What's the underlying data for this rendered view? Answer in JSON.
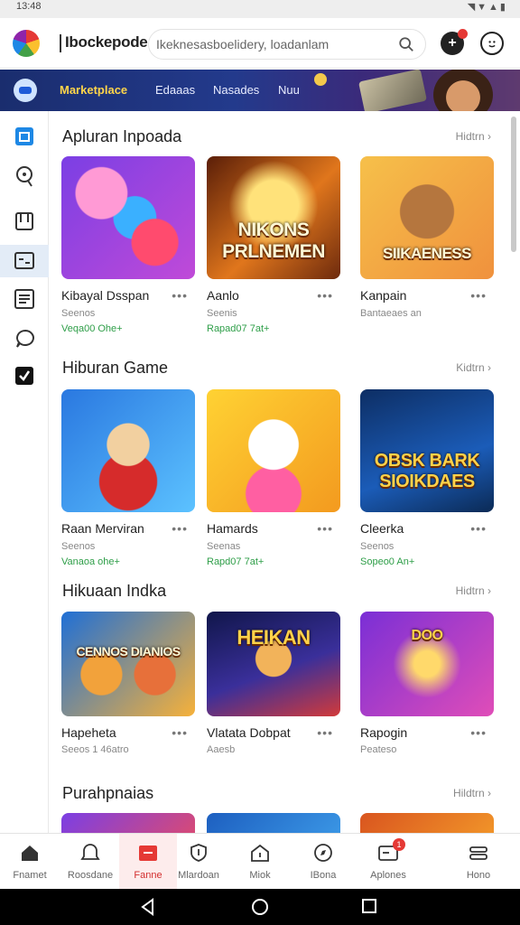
{
  "status_bar": {
    "time": "13:48"
  },
  "header": {
    "app_title": "Ibockepode",
    "search_placeholder": "Ikeknesasboelidery, loadanlam"
  },
  "banner": {
    "tabs": [
      {
        "label": "Marketplace",
        "active": true
      },
      {
        "label": "Edaaas",
        "active": false
      },
      {
        "label": "Nasades",
        "active": false
      },
      {
        "label": "Nuu",
        "active": false
      }
    ]
  },
  "sections": [
    {
      "title": "Apluran Inpoada",
      "see_all": "Hidtrn",
      "cards": [
        {
          "name": "Kibayal Dsspan",
          "sub": "Seenos",
          "meta": "Veqa00 Ohe+"
        },
        {
          "name": "Aanlo",
          "sub": "Seenis",
          "meta": "Rapad07 7at+",
          "art": "NIKONS PRLNEMEN"
        },
        {
          "name": "Kanpain",
          "sub": "Bantaeaes an",
          "meta": "",
          "art": "SIIKAENESS"
        }
      ]
    },
    {
      "title": "Hiburan Game",
      "see_all": "Kidtrn",
      "cards": [
        {
          "name": "Raan Merviran",
          "sub": "Seenos",
          "meta": "Vanaoa ohe+"
        },
        {
          "name": "Hamards",
          "sub": "Seenas",
          "meta": "Rapd07 7at+"
        },
        {
          "name": "Cleerka",
          "sub": "Seenos",
          "meta": "Sopeo0 An+",
          "art": "OBSK BARK SIOIKDAES"
        }
      ]
    },
    {
      "title": "Hikuaan Indka",
      "see_all": "Hidtrn",
      "cards": [
        {
          "name": "Hapeheta",
          "sub": "Seeos 1 46atro",
          "meta": "",
          "art": "CENNOS DIANIOS"
        },
        {
          "name": "Vlatata Dobpat",
          "sub": "Aaesb",
          "meta": "",
          "art": "HEIKAN"
        },
        {
          "name": "Rapogin",
          "sub": "Peateso",
          "meta": "",
          "art": "DOO"
        }
      ]
    },
    {
      "title": "Purahpnaias",
      "see_all": "Hildtrn",
      "cards": []
    }
  ],
  "bottom_nav": [
    {
      "label": "Fnamet",
      "icon": "home-icon",
      "active": false,
      "badge": ""
    },
    {
      "label": "Roosdane",
      "icon": "bell-icon",
      "active": false,
      "badge": ""
    },
    {
      "label": "Fanne",
      "icon": "store-icon",
      "active": true,
      "badge": ""
    },
    {
      "label": "Mlardoan",
      "icon": "shield-icon",
      "active": false,
      "badge": ""
    },
    {
      "label": "Miok",
      "icon": "house-icon",
      "active": false,
      "badge": ""
    },
    {
      "label": "IBona",
      "icon": "compass-icon",
      "active": false,
      "badge": ""
    },
    {
      "label": "Aplones",
      "icon": "mail-icon",
      "active": false,
      "badge": "1"
    },
    {
      "label": "Hono",
      "icon": "menu-icon",
      "active": false,
      "badge": ""
    }
  ],
  "colors": {
    "accent": "#d32f2f",
    "banner": "#233a8c",
    "active_tab": "#ffd54a",
    "meta_green": "#2e9e48"
  }
}
